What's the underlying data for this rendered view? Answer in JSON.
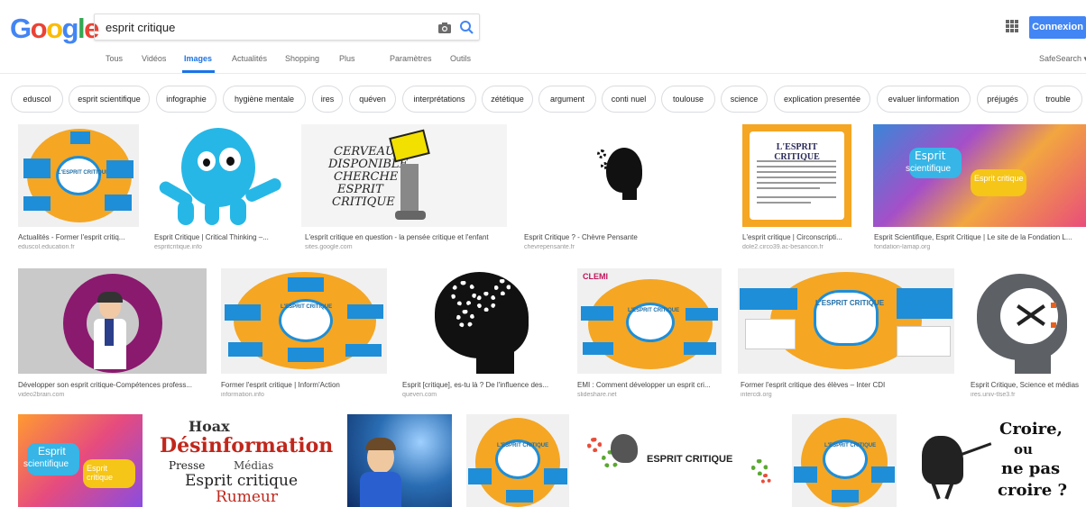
{
  "logo": [
    "G",
    "o",
    "o",
    "g",
    "l",
    "e"
  ],
  "search": {
    "query": "esprit critique"
  },
  "header": {
    "signin": "Connexion",
    "safesearch": "SafeSearch ▾"
  },
  "nav": {
    "tous": "Tous",
    "videos": "Vidéos",
    "images": "Images",
    "actualites": "Actualités",
    "shopping": "Shopping",
    "plus": "Plus",
    "parametres": "Paramètres",
    "outils": "Outils"
  },
  "chips": [
    "eduscol",
    "esprit scientifique",
    "infographie",
    "hygiène mentale",
    "ires",
    "quéven",
    "interprétations",
    "zététique",
    "argument",
    "conti nuel",
    "toulouse",
    "science",
    "explication presentée",
    "evaluer linformation",
    "préjugés",
    "trouble"
  ],
  "results_row1": [
    {
      "title": "Actualités - Former l'esprit critiq...",
      "source": "eduscol.education.fr"
    },
    {
      "title": "Esprit Critique | Critical Thinking –...",
      "source": "espritcritique.info"
    },
    {
      "title": "L'esprit critique en question - la pensée critique et l'enfant",
      "source": "sites.google.com"
    },
    {
      "title": "Esprit Critique ? - Chèvre Pensante",
      "source": "chevrepensante.fr"
    },
    {
      "title": "L'esprit critique | Circonscripti...",
      "source": "dole2.circo39.ac-besancon.fr"
    },
    {
      "title": "Esprit Scientifique, Esprit Critique | Le site de la Fondation L...",
      "source": "fondation-lamap.org"
    }
  ],
  "results_row2": [
    {
      "title": "Développer son esprit critique-Compétences profess...",
      "source": "video2brain.com"
    },
    {
      "title": "Former l'esprit critique | Inform'Action",
      "source": "information.info"
    },
    {
      "title": "Esprit [critique], es-tu là ? De l'influence des...",
      "source": "queven.com"
    },
    {
      "title": "EMI : Comment développer un esprit cri...",
      "source": "slideshare.net"
    },
    {
      "title": "Former l'esprit critique des élèves – Inter CDI",
      "source": "intercdi.org"
    },
    {
      "title": "Esprit Critique, Science et médias",
      "source": "ires.univ-tlse3.fr"
    }
  ],
  "image_text": {
    "infog_title": "L'ESPRIT CRITIQUE",
    "sketch_lines": [
      "CERVEAU",
      "DISPONIBLE",
      "CHERCHE",
      "ESPRIT",
      "CRITIQUE"
    ],
    "lamap_esprit": "Esprit",
    "lamap_scientifique": "scientifique",
    "lamap_critique": "Esprit critique",
    "esprit_critique_banner": "ESPRIT CRITIQUE",
    "croire_lines": [
      "Croire,",
      "ou",
      "ne pas",
      "croire ?"
    ],
    "cloud_words": [
      "Hoax",
      "Désinformation",
      "Presse",
      "Médias",
      "Esprit critique",
      "Rumeur"
    ]
  },
  "colors": {
    "accent": "#1a73e8",
    "signin_bg": "#4285f4",
    "infog_orange": "#f5a623",
    "infog_blue": "#1e8ed8"
  }
}
